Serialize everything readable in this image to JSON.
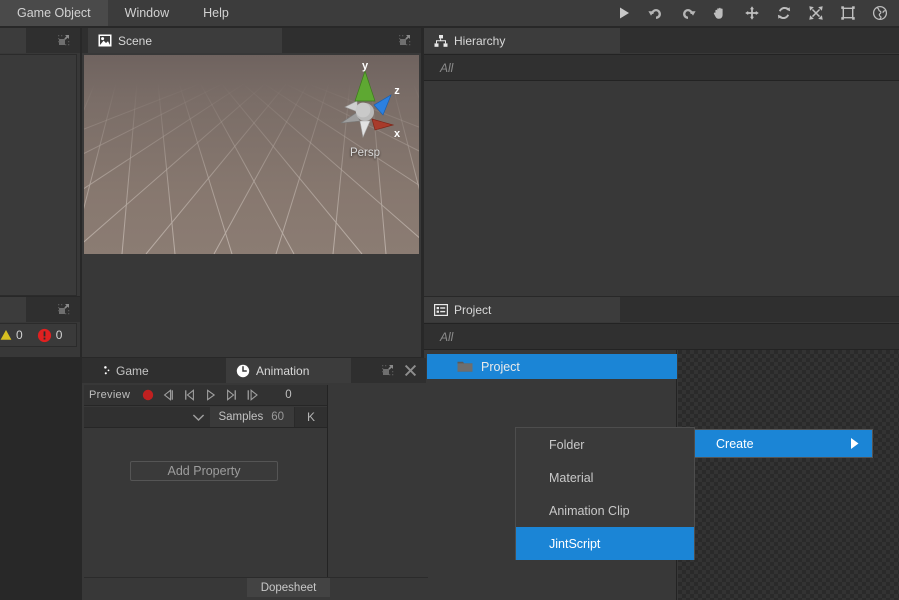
{
  "menubar": {
    "items": [
      {
        "label": "Game Object",
        "name": "menu-game-object"
      },
      {
        "label": "Window",
        "name": "menu-window"
      },
      {
        "label": "Help",
        "name": "menu-help"
      }
    ],
    "toolbar": [
      {
        "icon": "play-icon",
        "label": "Play"
      },
      {
        "icon": "undo-icon",
        "label": "Undo"
      },
      {
        "icon": "redo-icon",
        "label": "Redo"
      },
      {
        "icon": "hand-tool-icon",
        "label": "Hand Tool"
      },
      {
        "icon": "move-tool-icon",
        "label": "Move Tool"
      },
      {
        "icon": "rotate-tool-icon",
        "label": "Rotate Tool"
      },
      {
        "icon": "scale-tool-icon",
        "label": "Scale Tool"
      },
      {
        "icon": "rect-tool-icon",
        "label": "Rect Tool"
      },
      {
        "icon": "globe-icon",
        "label": "Global"
      }
    ]
  },
  "scene": {
    "tab_label": "Scene",
    "tab_icon": "scene-icon",
    "projection_label": "Persp",
    "gizmo_axes": [
      {
        "axis": "y",
        "color": "#5ea832"
      },
      {
        "axis": "z",
        "color": "#2b80e0"
      },
      {
        "axis": "x",
        "color": "#a83b2b"
      }
    ],
    "background_color": "#7b6e68",
    "grid_color": "#9a8e88"
  },
  "hierarchy": {
    "tab_label": "Hierarchy",
    "tab_icon": "hierarchy-icon",
    "search_placeholder": "All",
    "items": []
  },
  "project": {
    "tab_label": "Project",
    "tab_icon": "project-icon",
    "search_placeholder": "All",
    "rows": [
      {
        "label": "Project",
        "icon": "folder-icon",
        "selected": true
      }
    ],
    "selection_color": "#1b85d6"
  },
  "game_animation": {
    "tabs": [
      {
        "label": "Game",
        "icon": "game-icon",
        "active": false
      },
      {
        "label": "Animation",
        "icon": "clock-icon",
        "active": true
      }
    ],
    "preview_label": "Preview",
    "playback_controls": [
      {
        "icon": "record-icon",
        "label": "Record"
      },
      {
        "icon": "prev-keyframe-icon",
        "label": "Previous Keyframe"
      },
      {
        "icon": "skip-start-icon",
        "label": "First Frame"
      },
      {
        "icon": "play-icon",
        "label": "Play"
      },
      {
        "icon": "skip-end-icon",
        "label": "Last Frame"
      },
      {
        "icon": "next-keyframe-icon",
        "label": "Next Keyframe"
      }
    ],
    "frame_value": "0",
    "samples_label": "Samples",
    "samples_value": "60",
    "key_button_label": "K",
    "add_property_label": "Add Property",
    "dopesheet_label": "Dopesheet"
  },
  "console": {
    "warning_count": "0",
    "error_count": "0",
    "warning_color": "#d8c020",
    "error_color": "#e02020"
  },
  "context_menu": {
    "parent": {
      "label": "Create",
      "icon": "submenu-arrow-icon",
      "highlighted": true
    },
    "items": [
      {
        "label": "Folder",
        "selected": false
      },
      {
        "label": "Material",
        "selected": false
      },
      {
        "label": "Animation Clip",
        "selected": false
      },
      {
        "label": "JintScript",
        "selected": true
      }
    ],
    "highlight_color": "#1b85d6"
  }
}
